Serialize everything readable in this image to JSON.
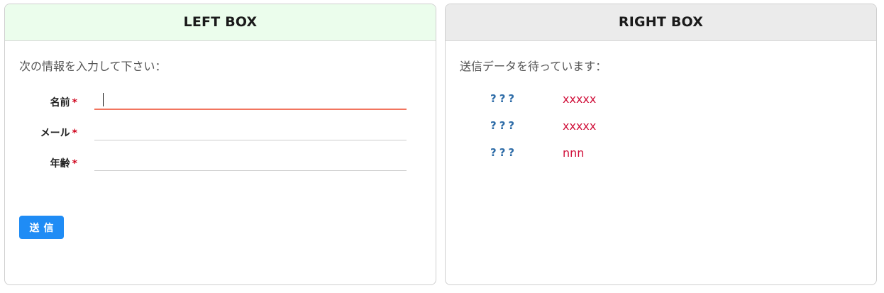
{
  "left_box": {
    "title": "LEFT BOX",
    "intro": "次の情報を入力して下さい：",
    "fields": [
      {
        "label": "名前",
        "required": "*",
        "value": "",
        "placeholder": ""
      },
      {
        "label": "メール",
        "required": "*",
        "value": "",
        "placeholder": ""
      },
      {
        "label": "年齢",
        "required": "*",
        "value": "",
        "placeholder": ""
      }
    ],
    "submit_label": "送信"
  },
  "right_box": {
    "title": "RIGHT BOX",
    "intro": "送信データを待っています：",
    "rows": [
      {
        "key": "???",
        "value": "xxxxx"
      },
      {
        "key": "???",
        "value": "xxxxx"
      },
      {
        "key": "???",
        "value": "nnn"
      }
    ]
  },
  "colors": {
    "left_header_bg": "#ebfdec",
    "right_header_bg": "#ebebeb",
    "active_underline": "#f2755f",
    "button": "#1f8cf5",
    "required": "#d0021b",
    "value_text": "#d0103a",
    "key_text": "#2f6da8"
  }
}
